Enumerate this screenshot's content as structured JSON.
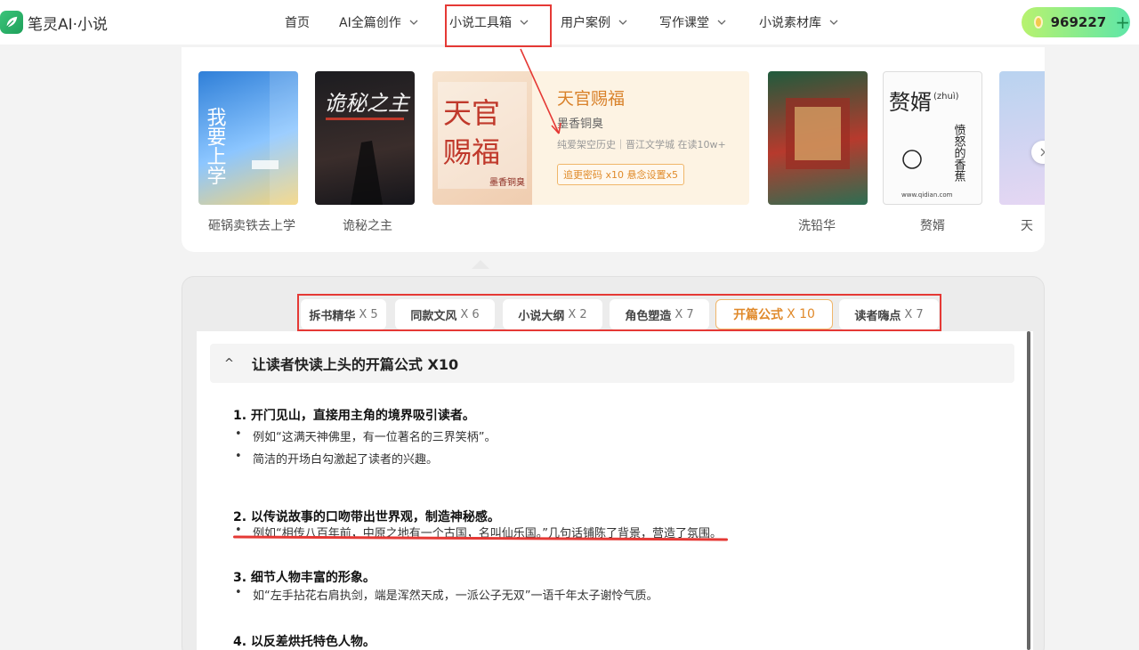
{
  "header": {
    "logo_text": "笔灵AI·小说",
    "nav": [
      {
        "label": "首页",
        "has_dropdown": false
      },
      {
        "label": "AI全篇创作",
        "has_dropdown": true
      },
      {
        "label": "小说工具箱",
        "has_dropdown": true,
        "highlighted": true
      },
      {
        "label": "用户案例",
        "has_dropdown": true
      },
      {
        "label": "写作课堂",
        "has_dropdown": true
      },
      {
        "label": "小说素材库",
        "has_dropdown": true
      }
    ],
    "coins": "969227",
    "coins_add": "+"
  },
  "carousel": {
    "books": [
      {
        "title": "砸锅卖铁去上学",
        "cover_text": "我要上学"
      },
      {
        "title": "诡秘之主",
        "cover_text": "诡秘之主"
      },
      {
        "title": "洗铅华",
        "cover_text": ""
      },
      {
        "title": "赘婿",
        "cover_text": "赘婿",
        "cover_sub": "(zhuì)",
        "cover_author": "愤怒的香蕉",
        "cover_site": "www.qidian.com"
      },
      {
        "title": "天",
        "cover_text": ""
      }
    ],
    "featured": {
      "title": "天官赐福",
      "author": "墨香铜臭",
      "meta": "纯爱架空历史｜晋江文学城 在读10w+",
      "tag": "追更密码 x10 悬念设置x5",
      "cover_text_a": "天官",
      "cover_text_b": "赐福",
      "cover_author": "墨香铜臭"
    }
  },
  "tabs": [
    {
      "label": "拆书精华",
      "count": "X 5"
    },
    {
      "label": "同款文风",
      "count": "X 6"
    },
    {
      "label": "小说大纲",
      "count": "X 2"
    },
    {
      "label": "角色塑造",
      "count": "X 7"
    },
    {
      "label": "开篇公式",
      "count": "X 10",
      "active": true
    },
    {
      "label": "读者嗨点",
      "count": "X 7"
    }
  ],
  "section": {
    "collapse_glyph": "^",
    "title": "让读者快读上头的开篇公式 X10",
    "points": [
      {
        "title": "1. 开门见山，直接用主角的境界吸引读者。",
        "bullets": [
          "例如“这满天神佛里，有一位著名的三界笑柄”。",
          "简洁的开场白勾激起了读者的兴趣。"
        ]
      },
      {
        "title": "2. 以传说故事的口吻带出世界观，制造神秘感。",
        "bullets": [
          "例如“相传八百年前，中原之地有一个古国，名叫仙乐国。”几句话铺陈了背景，营造了氛围。"
        ]
      },
      {
        "title": "3. 细节人物丰富的形象。",
        "bullets": [
          "如“左手拈花右肩执剑，端是浑然天成，一派公子无双”一语千年太子谢怜气质。"
        ]
      },
      {
        "title": "4. 以反差烘托特色人物。",
        "bullets": []
      }
    ]
  },
  "colors": {
    "accent_orange": "#e0892a",
    "highlight_red": "#e53935",
    "brand_green": "#1ea05a"
  }
}
